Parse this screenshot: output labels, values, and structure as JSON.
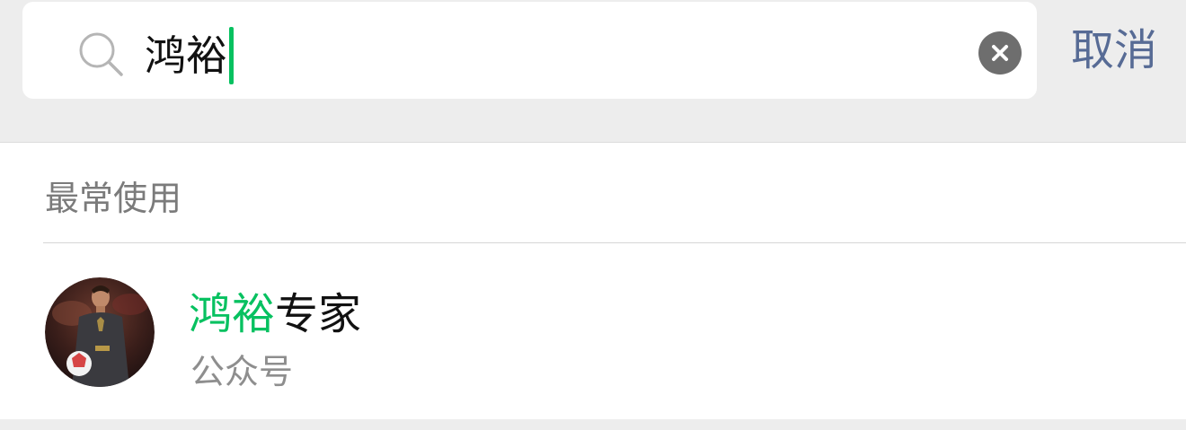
{
  "search": {
    "query": "鸿裕",
    "cancel_label": "取消",
    "icon": "search-icon",
    "clear_icon": "clear-icon"
  },
  "section": {
    "title": "最常使用"
  },
  "results": [
    {
      "title_highlight": "鸿裕",
      "title_rest": "专家",
      "subtitle": "公众号",
      "avatar": "avatar-photo"
    }
  ],
  "colors": {
    "accent": "#07c160",
    "link": "#576b95",
    "background": "#ededed"
  }
}
